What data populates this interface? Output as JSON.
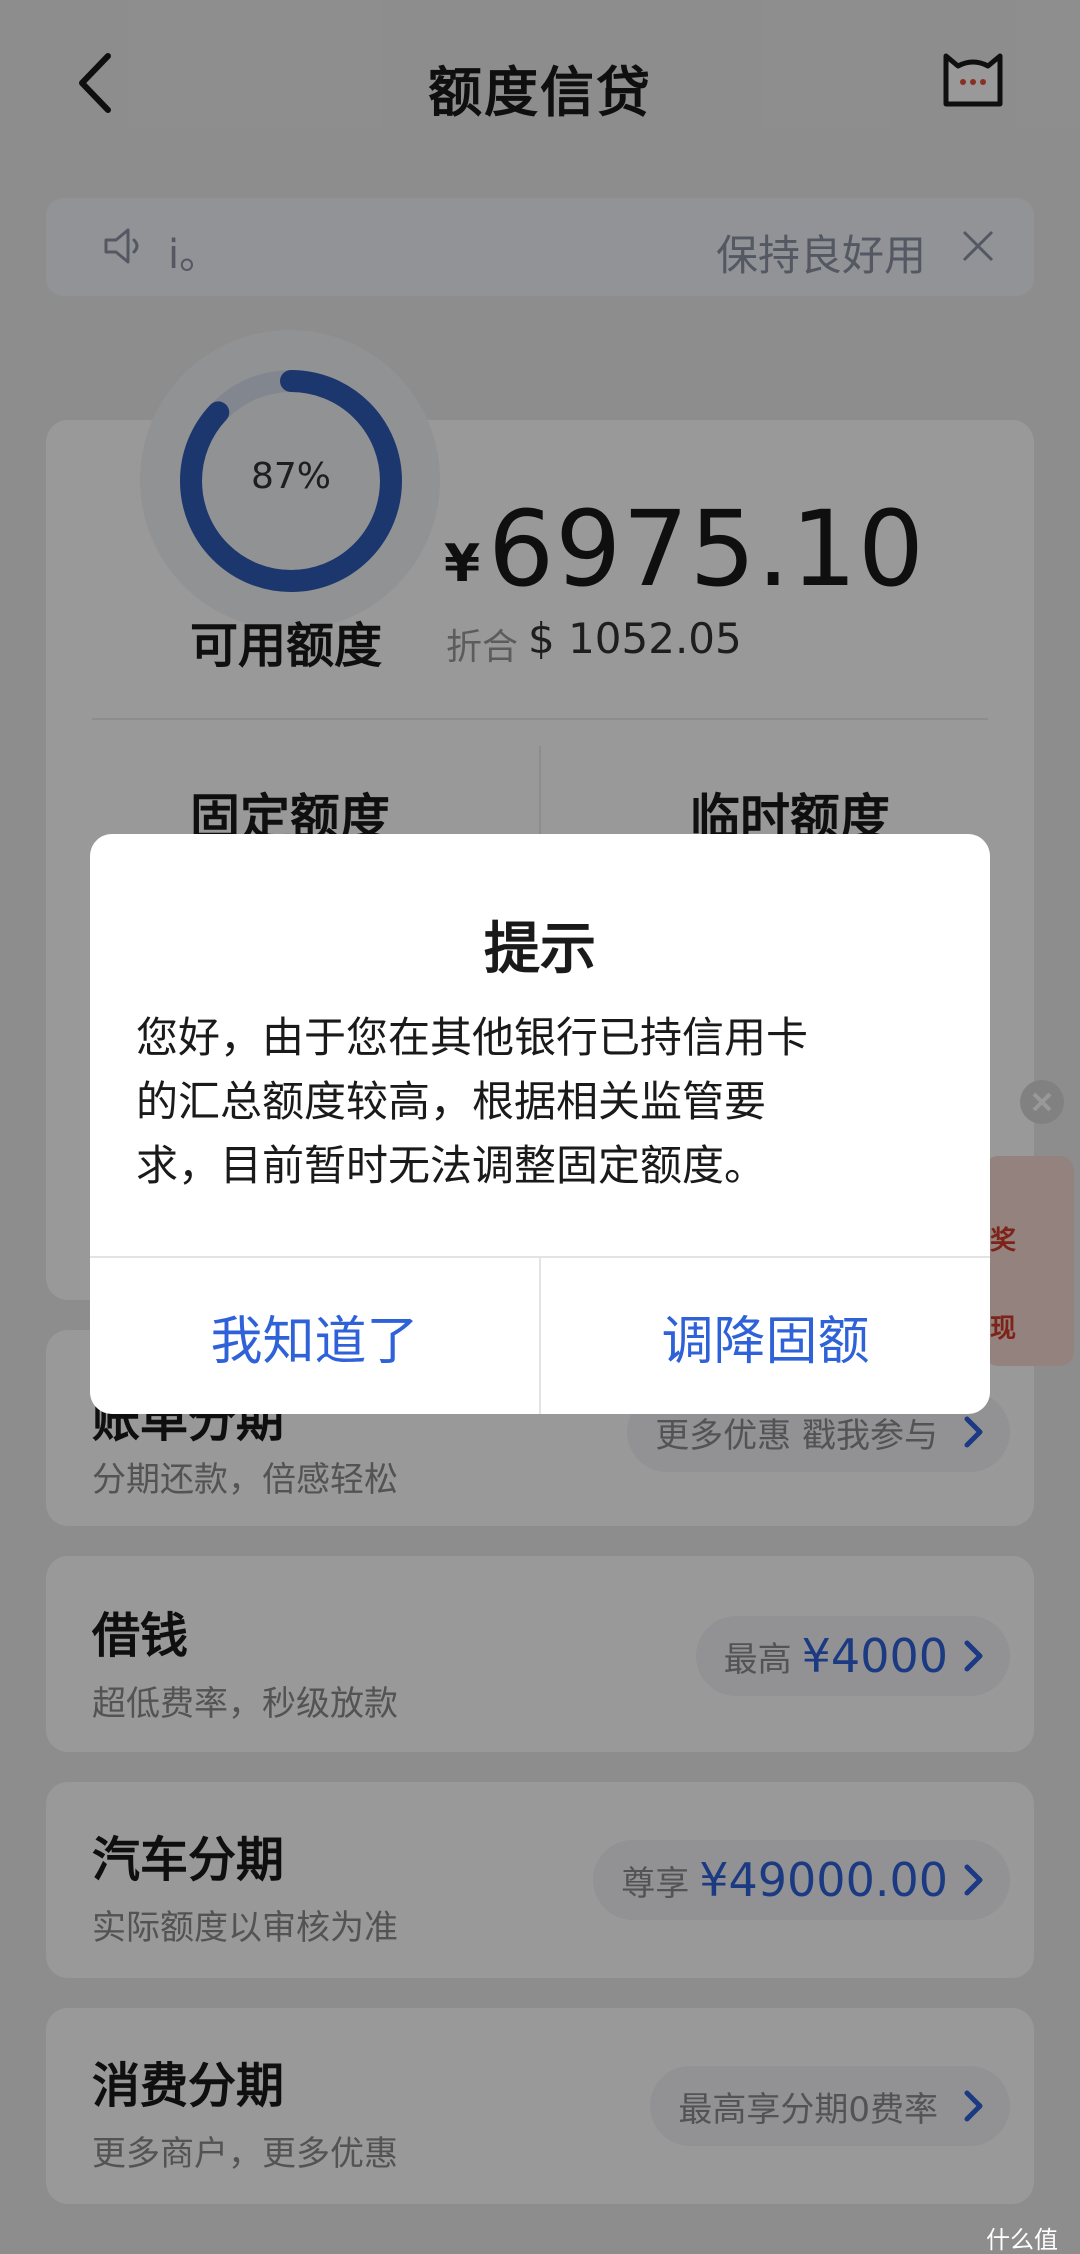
{
  "header": {
    "title": "额度信贷"
  },
  "notice": {
    "text_left": "ⅰ。",
    "text_right": "保持良好用"
  },
  "credit": {
    "usage_percent_label": "87%",
    "usage_fraction": 0.87,
    "available_label": "可用额度",
    "currency_symbol": "¥",
    "available_amount": "6975.10",
    "converted_label": "折合",
    "converted_amount": "$ 1052.05",
    "fixed_label": "固定额度",
    "temp_label": "临时额度"
  },
  "services": [
    {
      "title": "账单分期",
      "subtitle": "分期还款，倍感轻松",
      "pill_label": "",
      "pill_value": "更多优惠 戳我参与"
    },
    {
      "title": "借钱",
      "subtitle": "超低费率，秒级放款",
      "pill_label": "最高",
      "pill_value": "¥4000"
    },
    {
      "title": "汽车分期",
      "subtitle": "实际额度以审核为准",
      "pill_label": "尊享",
      "pill_value": "¥49000.00"
    },
    {
      "title": "消费分期",
      "subtitle": "更多商户，更多优惠",
      "pill_label": "",
      "pill_value": "最高享分期0费率"
    }
  ],
  "float_badge": {
    "line1": "奖",
    "line2": "现"
  },
  "dialog": {
    "title": "提示",
    "line1": "您好，由于您在其他银行已持信用卡",
    "line2": "的汇总额度较高，根据相关监管要",
    "line3": "求，目前暂时无法调整固定额度。",
    "btn_ok": "我知道了",
    "btn_reduce": "调降固额"
  },
  "watermark": "什么值得买",
  "colors": {
    "accent": "#2f62d8",
    "ring": "#2f5bb8"
  }
}
